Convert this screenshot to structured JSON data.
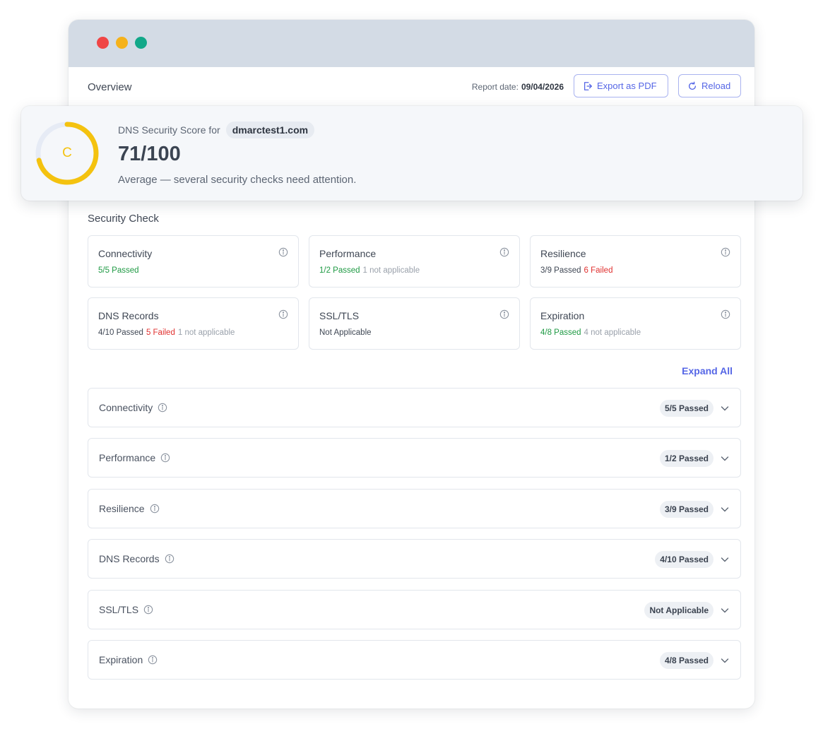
{
  "window": {
    "dots": [
      "close",
      "minimize",
      "maximize"
    ]
  },
  "header": {
    "title": "Overview",
    "report_date_label": "Report date:",
    "report_date_value": "09/04/2026",
    "export_label": "Export as PDF",
    "reload_label": "Reload"
  },
  "score": {
    "label": "DNS Security Score for",
    "domain": "dmarctest1.com",
    "grade": "C",
    "value": "71/100",
    "score_fraction": 0.71,
    "description": "Average — several security checks need attention.",
    "gauge_color": "#f4c20f"
  },
  "security_check": {
    "title": "Security Check",
    "cards": [
      {
        "title": "Connectivity",
        "passed": "5/5 Passed",
        "passed_green": true,
        "failed": "",
        "na": ""
      },
      {
        "title": "Performance",
        "passed": "1/2 Passed",
        "passed_green": true,
        "failed": "",
        "na": "1 not applicable"
      },
      {
        "title": "Resilience",
        "passed": "3/9 Passed",
        "passed_green": false,
        "failed": "6 Failed",
        "na": ""
      },
      {
        "title": "DNS Records",
        "passed": "4/10 Passed",
        "passed_green": false,
        "failed": "5 Failed",
        "na": "1 not applicable"
      },
      {
        "title": "SSL/TLS",
        "passed": "Not Applicable",
        "passed_green": false,
        "failed": "",
        "na": ""
      },
      {
        "title": "Expiration",
        "passed": "4/8 Passed",
        "passed_green": true,
        "failed": "",
        "na": "4 not applicable"
      }
    ]
  },
  "expand_all_label": "Expand All",
  "accordion": [
    {
      "title": "Connectivity",
      "badge": "5/5 Passed"
    },
    {
      "title": "Performance",
      "badge": "1/2 Passed"
    },
    {
      "title": "Resilience",
      "badge": "3/9 Passed"
    },
    {
      "title": "DNS Records",
      "badge": "4/10 Passed"
    },
    {
      "title": "SSL/TLS",
      "badge": "Not Applicable"
    },
    {
      "title": "Expiration",
      "badge": "4/8 Passed"
    }
  ],
  "colors": {
    "accent": "#5566e6",
    "passed": "#1f9a44",
    "failed": "#e0302f",
    "muted": "#9aa1ab"
  }
}
